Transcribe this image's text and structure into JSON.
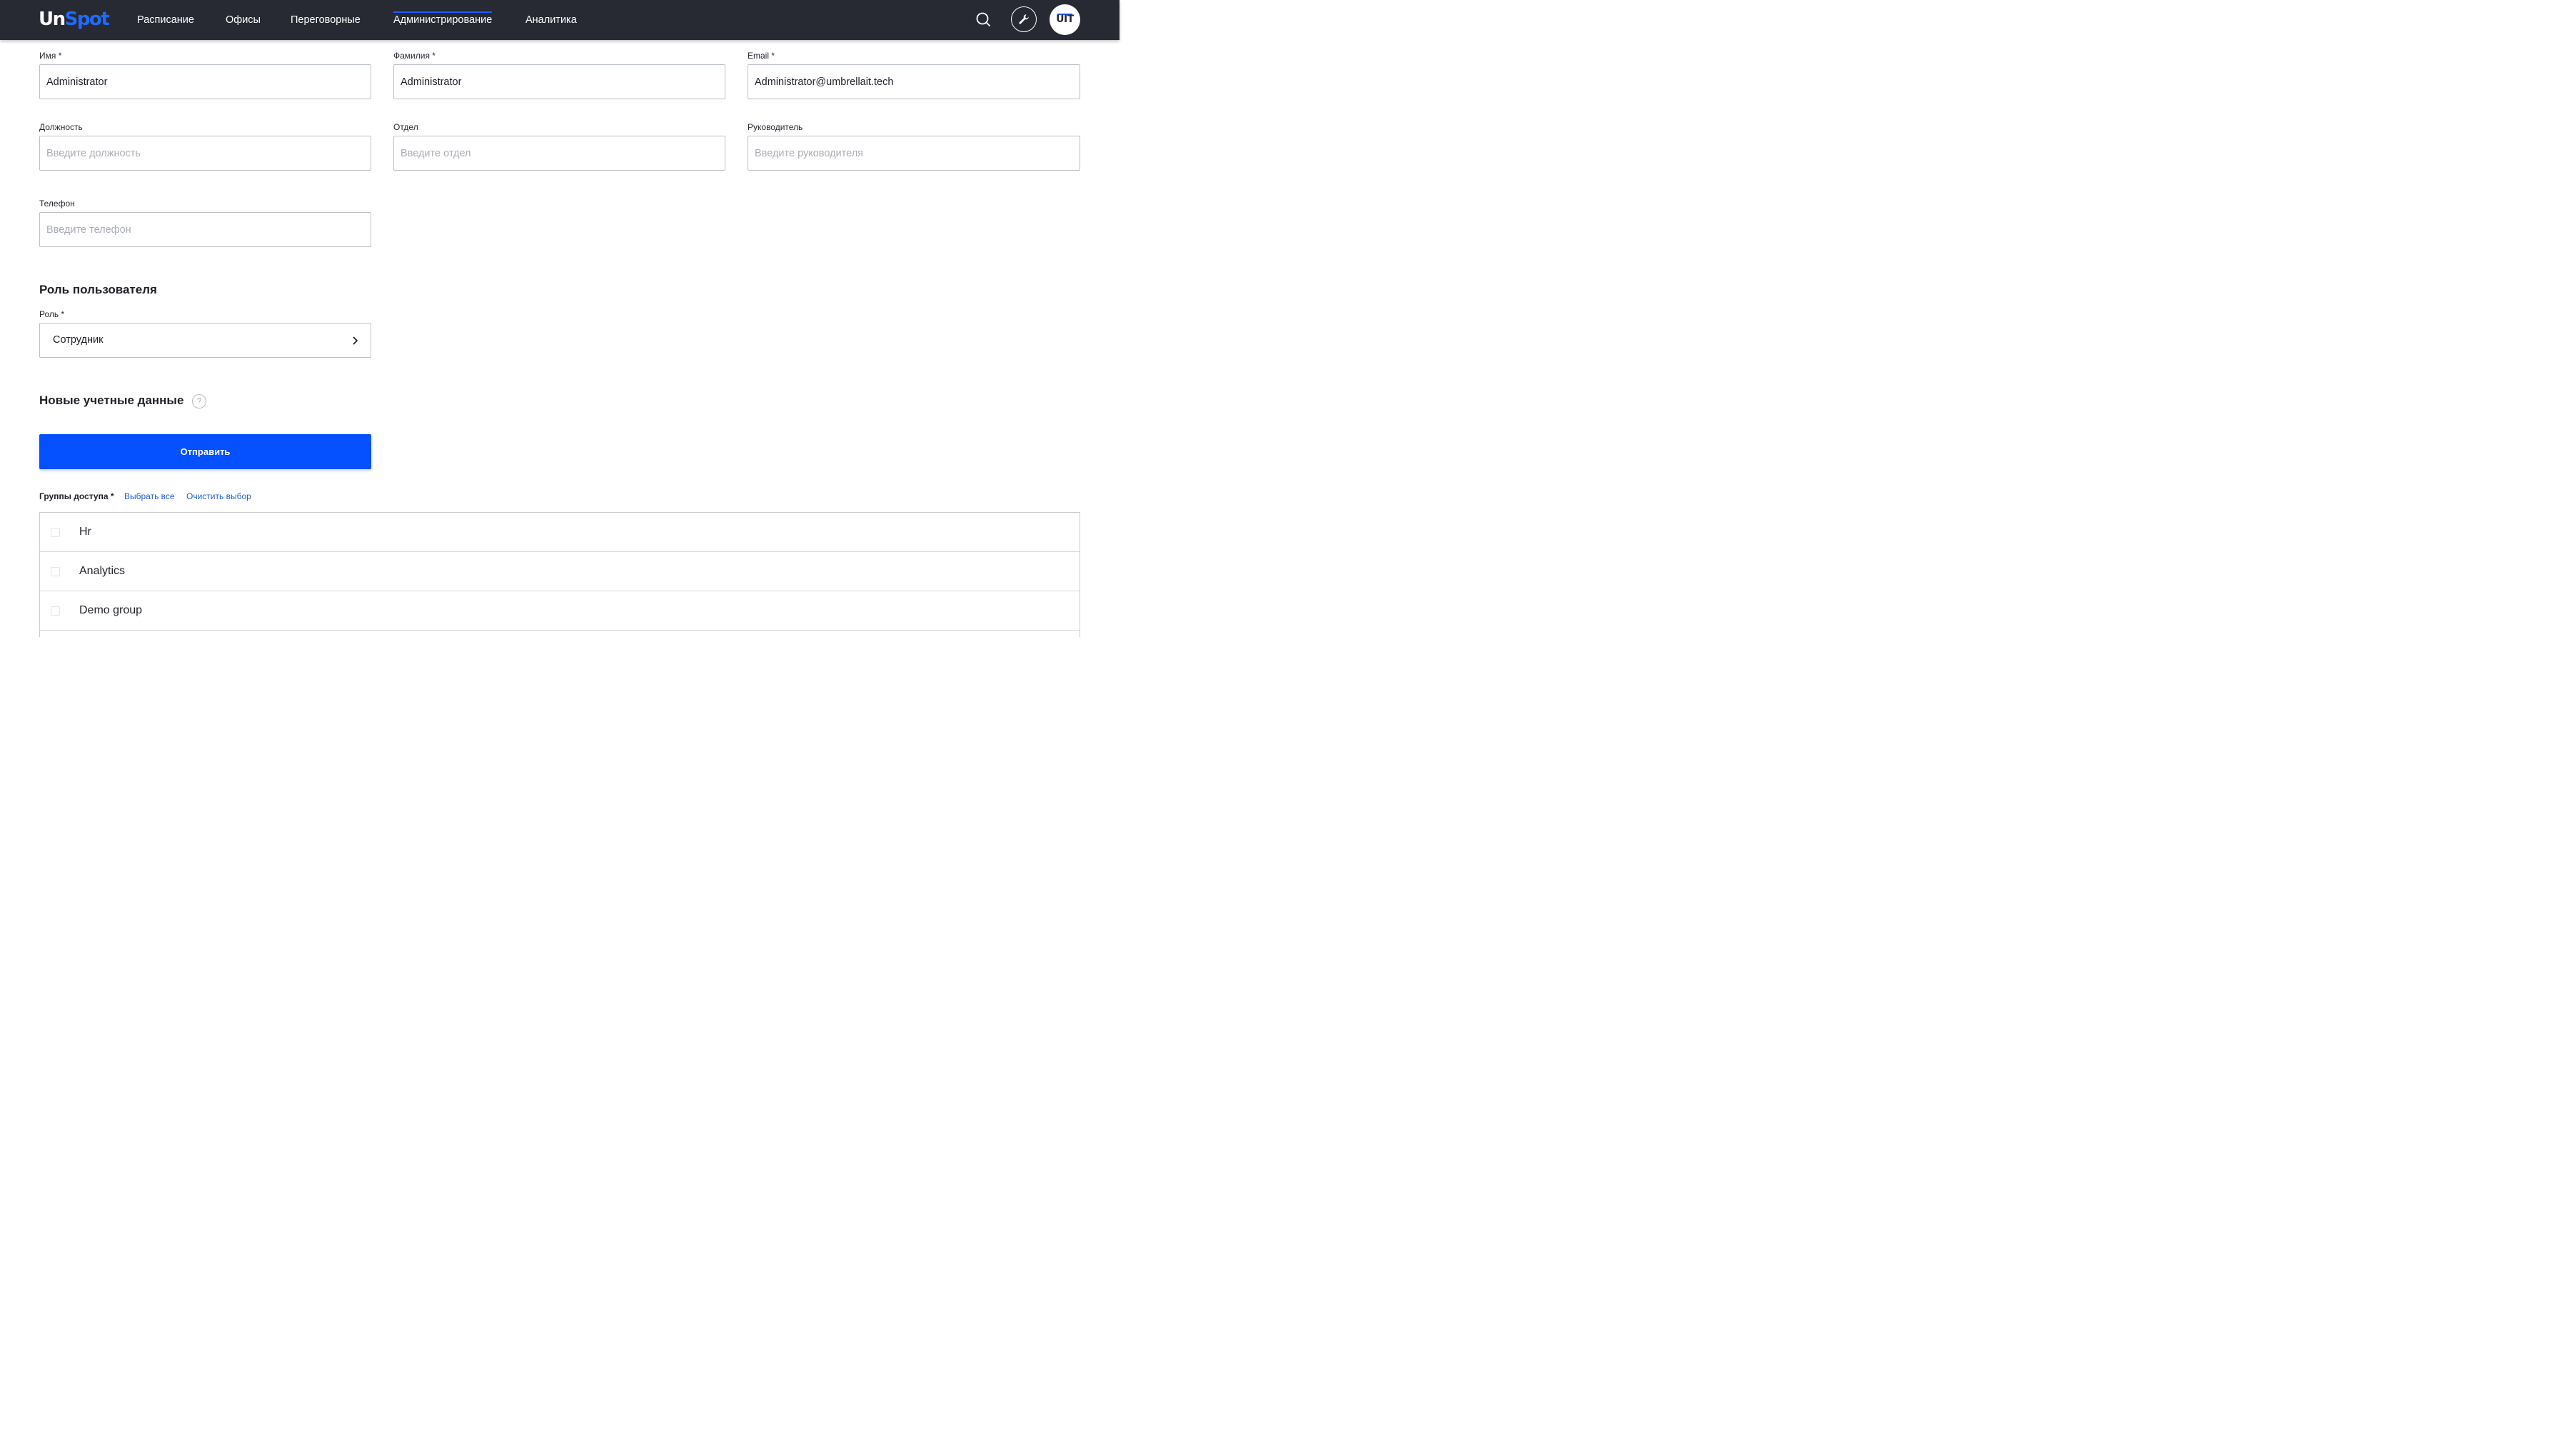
{
  "header": {
    "logo": {
      "part1": "Un",
      "part2": "Spot"
    },
    "nav": [
      {
        "label": "Расписание"
      },
      {
        "label": "Офисы"
      },
      {
        "label": "Переговорные"
      },
      {
        "label": "Администрирование",
        "active": true
      },
      {
        "label": "Аналитика"
      }
    ],
    "icons": {
      "search": "search-icon",
      "settings": "wrench-icon"
    },
    "avatar_text": "UIT",
    "accent_color": "#1a5cff",
    "background": "#272a33"
  },
  "form": {
    "first_name": {
      "label": "Имя *",
      "value": "Administrator"
    },
    "last_name": {
      "label": "Фамилия *",
      "value": "Administrator"
    },
    "email": {
      "label": "Email *",
      "value": "Administrator@umbrellait.tech"
    },
    "position": {
      "label": "Должность",
      "placeholder": "Введите должность"
    },
    "department": {
      "label": "Отдел",
      "placeholder": "Введите отдел"
    },
    "manager": {
      "label": "Руководитель",
      "placeholder": "Введите руководителя"
    },
    "phone": {
      "label": "Телефон",
      "placeholder": "Введите телефон"
    }
  },
  "role_section": {
    "title": "Роль пользователя",
    "role_label": "Роль *",
    "role_value": "Сотрудник"
  },
  "credentials": {
    "title": "Новые учетные данные",
    "help": "?",
    "submit_label": "Отправить",
    "submit_color": "#0551ff"
  },
  "access_groups": {
    "label": "Группы доступа *",
    "select_all": "Выбрать все",
    "clear": "Очистить выбор",
    "items": [
      {
        "name": "Hr",
        "checked": false
      },
      {
        "name": "Analytics",
        "checked": false
      },
      {
        "name": "Demo group",
        "checked": false
      }
    ]
  }
}
